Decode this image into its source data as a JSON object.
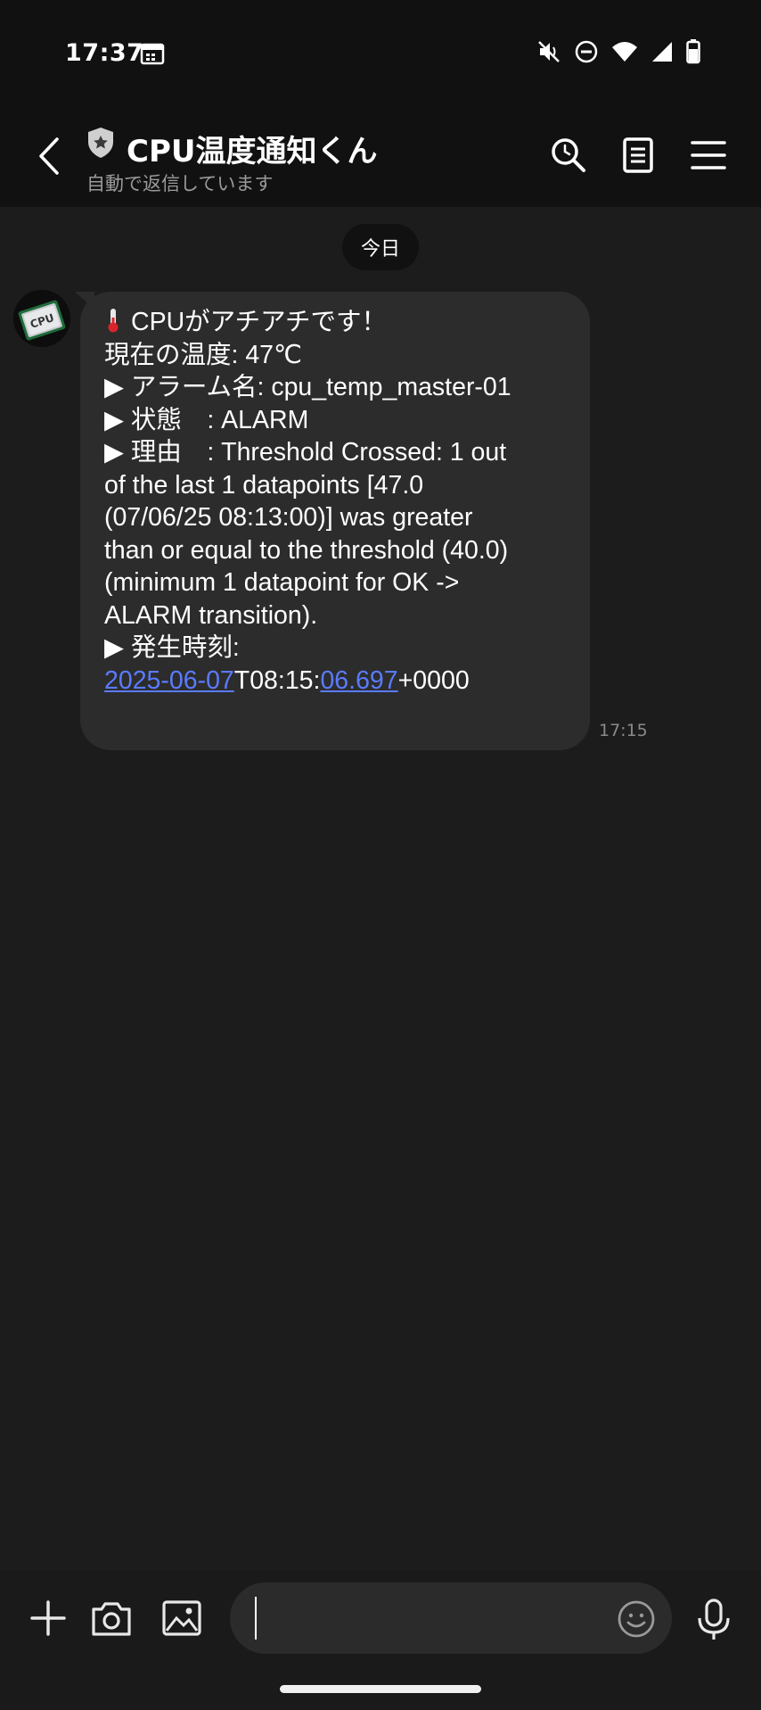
{
  "status_bar": {
    "time": "17:37",
    "icons": [
      "calendar-icon",
      "mute-icon",
      "dnd-icon",
      "wifi-icon",
      "signal-icon",
      "battery-icon"
    ]
  },
  "header": {
    "title": "CPU温度通知くん",
    "subtitle": "自動で返信しています",
    "icons": [
      "back-icon",
      "shield-icon",
      "search-icon",
      "note-icon",
      "menu-icon"
    ]
  },
  "chat": {
    "date_label": "今日",
    "avatar_text": "CPU",
    "message": {
      "line1": "CPUがアチアチです！",
      "line2": "現在の温度: 47℃",
      "line3": "▶ アラーム名: cpu_temp_master-01",
      "line4": "▶ 状態　: ALARM",
      "line5": "▶ 理由　: Threshold Crossed: 1 out",
      "line6": "of the last 1 datapoints [47.0",
      "line7": "(07/06/25 08:13:00)] was greater",
      "line8": "than or equal to the threshold (40.0)",
      "line9": "(minimum 1 datapoint for OK ->",
      "line10": "ALARM transition).",
      "line11": "▶ 発生時刻:",
      "ts_date": "2025-06-07",
      "ts_mid": "T08:15:",
      "ts_sec": "06.697",
      "ts_tz": "+0000"
    },
    "time": "17:15"
  },
  "composer": {
    "input_value": "",
    "icons": [
      "plus-icon",
      "camera-icon",
      "image-icon",
      "emoji-icon",
      "mic-icon"
    ]
  },
  "colors": {
    "background": "#1c1c1c",
    "bar": "#111111",
    "bubble": "#2c2c2c",
    "link": "#5a7bff"
  }
}
